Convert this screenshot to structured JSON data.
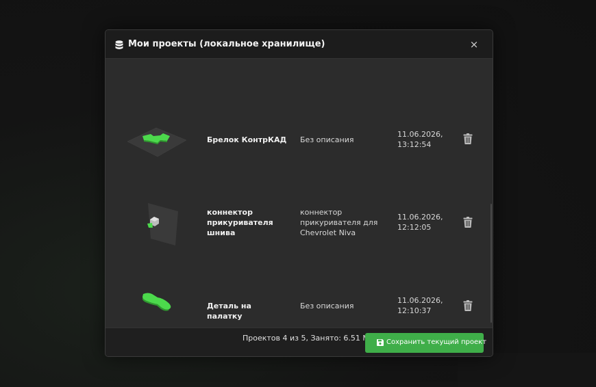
{
  "modal": {
    "title": "Мои проекты (локальное хранилище)",
    "close_label": "×"
  },
  "projects": [
    {
      "name": "Брелок КонтрКАД",
      "description": "Без описания",
      "date": "11.06.2026,",
      "time": "13:12:54"
    },
    {
      "name": "коннектор прикуривателя шнива",
      "description": "коннектор прикуривателя для Chevrolet Niva",
      "date": "11.06.2026,",
      "time": "12:12:05"
    },
    {
      "name": "Деталь на палатку",
      "description": "Без описания",
      "date": "11.06.2026,",
      "time": "12:10:37"
    }
  ],
  "footer": {
    "stats": "Проектов 4 из 5, Занято: 6.51 МБ",
    "save_label": "Сохранить текущий проект"
  },
  "colors": {
    "accent": "#3fae49",
    "model_green": "#4cd94c",
    "header_bg": "#1c1c1c",
    "body_bg": "#2c2c2c"
  },
  "icons": {
    "title": "database-icon",
    "close": "close-icon",
    "delete": "trash-icon",
    "save": "floppy-disk-icon"
  }
}
